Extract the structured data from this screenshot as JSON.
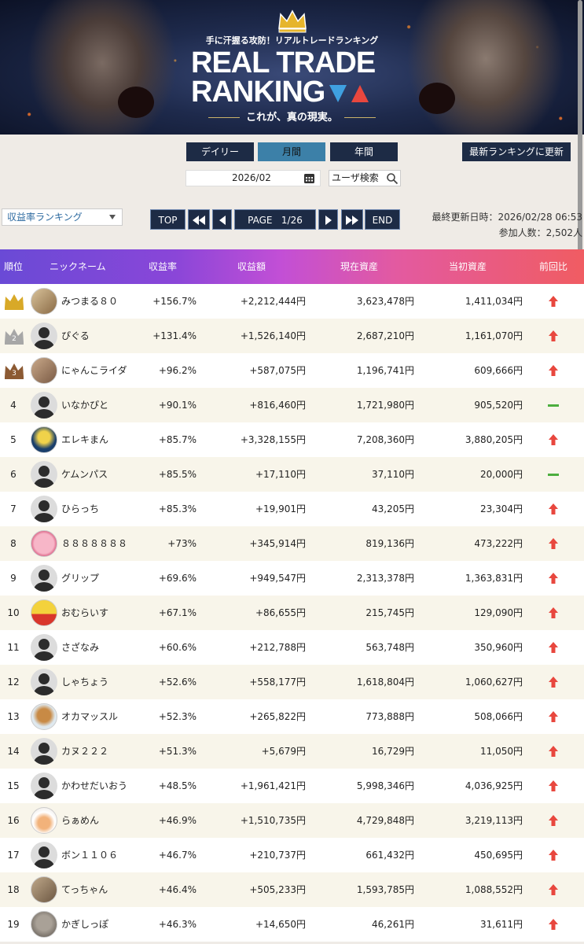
{
  "banner": {
    "tagline": "手に汗握る攻防！リアルトレードランキング",
    "logo_line1": "REAL TRADE",
    "logo_line2": "RANKING",
    "subcopy": "これが、真の現実。"
  },
  "period_tabs": [
    {
      "label": "デイリー",
      "active": false
    },
    {
      "label": "月間",
      "active": true
    },
    {
      "label": "年間",
      "active": false
    }
  ],
  "refresh_label": "最新ランキングに更新",
  "date_value": "2026/02",
  "user_search_label": "ユーザ検索",
  "ranking_select": "収益率ランキング",
  "pagination": {
    "top": "TOP",
    "page_label": "PAGE",
    "page_value": "1/26",
    "end": "END"
  },
  "update_info": {
    "last_updated": "最終更新日時：2026/02/28 06:53",
    "participants": "参加人数：2,502人"
  },
  "table": {
    "headers": [
      "順位",
      "ニックネーム",
      "収益率",
      "収益額",
      "現在資産",
      "当初資産",
      "前回比"
    ],
    "rows": [
      {
        "rank": "",
        "medal": "gold",
        "avatar": "bird",
        "name": "みつまる８０",
        "rate": "+156.7%",
        "profit": "+2,212,444円",
        "current": "3,623,478円",
        "initial": "1,411,034円",
        "trend": "up"
      },
      {
        "rank": "",
        "medal": "silver",
        "avatar": "default",
        "name": "ぴぐる",
        "rate": "+131.4%",
        "profit": "+1,526,140円",
        "current": "2,687,210円",
        "initial": "1,161,070円",
        "trend": "up"
      },
      {
        "rank": "",
        "medal": "bronze",
        "avatar": "cat",
        "name": "にゃんこライダ",
        "rate": "+96.2%",
        "profit": "+587,075円",
        "current": "1,196,741円",
        "initial": "609,666円",
        "trend": "up"
      },
      {
        "rank": "4",
        "medal": "",
        "avatar": "default",
        "name": "いなかぴと",
        "rate": "+90.1%",
        "profit": "+816,460円",
        "current": "1,721,980円",
        "initial": "905,520円",
        "trend": "flat"
      },
      {
        "rank": "5",
        "medal": "",
        "avatar": "electric",
        "name": "エレキまん",
        "rate": "+85.7%",
        "profit": "+3,328,155円",
        "current": "7,208,360円",
        "initial": "3,880,205円",
        "trend": "up"
      },
      {
        "rank": "6",
        "medal": "",
        "avatar": "default",
        "name": "ケムンパス",
        "rate": "+85.5%",
        "profit": "+17,110円",
        "current": "37,110円",
        "initial": "20,000円",
        "trend": "flat"
      },
      {
        "rank": "7",
        "medal": "",
        "avatar": "default",
        "name": "ひらっち",
        "rate": "+85.3%",
        "profit": "+19,901円",
        "current": "43,205円",
        "initial": "23,304円",
        "trend": "up"
      },
      {
        "rank": "8",
        "medal": "",
        "avatar": "pink",
        "name": "８８８８８８８",
        "rate": "+73%",
        "profit": "+345,914円",
        "current": "819,136円",
        "initial": "473,222円",
        "trend": "up"
      },
      {
        "rank": "9",
        "medal": "",
        "avatar": "default",
        "name": "グリップ",
        "rate": "+69.6%",
        "profit": "+949,547円",
        "current": "2,313,378円",
        "initial": "1,363,831円",
        "trend": "up"
      },
      {
        "rank": "10",
        "medal": "",
        "avatar": "fruit",
        "name": "おむらいす",
        "rate": "+67.1%",
        "profit": "+86,655円",
        "current": "215,745円",
        "initial": "129,090円",
        "trend": "up"
      },
      {
        "rank": "11",
        "medal": "",
        "avatar": "default",
        "name": "さざなみ",
        "rate": "+60.6%",
        "profit": "+212,788円",
        "current": "563,748円",
        "initial": "350,960円",
        "trend": "up"
      },
      {
        "rank": "12",
        "medal": "",
        "avatar": "default",
        "name": "しゃちょう",
        "rate": "+52.6%",
        "profit": "+558,177円",
        "current": "1,618,804円",
        "initial": "1,060,627円",
        "trend": "up"
      },
      {
        "rank": "13",
        "medal": "",
        "avatar": "dog",
        "name": "オカマッスル",
        "rate": "+52.3%",
        "profit": "+265,822円",
        "current": "773,888円",
        "initial": "508,066円",
        "trend": "up"
      },
      {
        "rank": "14",
        "medal": "",
        "avatar": "default",
        "name": "カヌ２２２",
        "rate": "+51.3%",
        "profit": "+5,679円",
        "current": "16,729円",
        "initial": "11,050円",
        "trend": "up"
      },
      {
        "rank": "15",
        "medal": "",
        "avatar": "default",
        "name": "かわせだいおう",
        "rate": "+48.5%",
        "profit": "+1,961,421円",
        "current": "5,998,346円",
        "initial": "4,036,925円",
        "trend": "up"
      },
      {
        "rank": "16",
        "medal": "",
        "avatar": "ramen",
        "name": "らぁめん",
        "rate": "+46.9%",
        "profit": "+1,510,735円",
        "current": "4,729,848円",
        "initial": "3,219,113円",
        "trend": "up"
      },
      {
        "rank": "17",
        "medal": "",
        "avatar": "default",
        "name": "ボン１１０６",
        "rate": "+46.7%",
        "profit": "+210,737円",
        "current": "661,432円",
        "initial": "450,695円",
        "trend": "up"
      },
      {
        "rank": "18",
        "medal": "",
        "avatar": "pyramid",
        "name": "てっちゃん",
        "rate": "+46.4%",
        "profit": "+505,233円",
        "current": "1,593,785円",
        "initial": "1,088,552円",
        "trend": "up"
      },
      {
        "rank": "19",
        "medal": "",
        "avatar": "cat2",
        "name": "かぎしっぽ",
        "rate": "+46.3%",
        "profit": "+14,650円",
        "current": "46,261円",
        "initial": "31,611円",
        "trend": "up"
      }
    ]
  },
  "colors": {
    "navy_button": "#1d2b45",
    "active_tab": "#3c80a8",
    "trend_up": "#e8473e",
    "trend_flat": "#4cae3f",
    "gold": "#d8a928",
    "silver": "#a7a7a7",
    "bronze": "#8c5a33"
  }
}
